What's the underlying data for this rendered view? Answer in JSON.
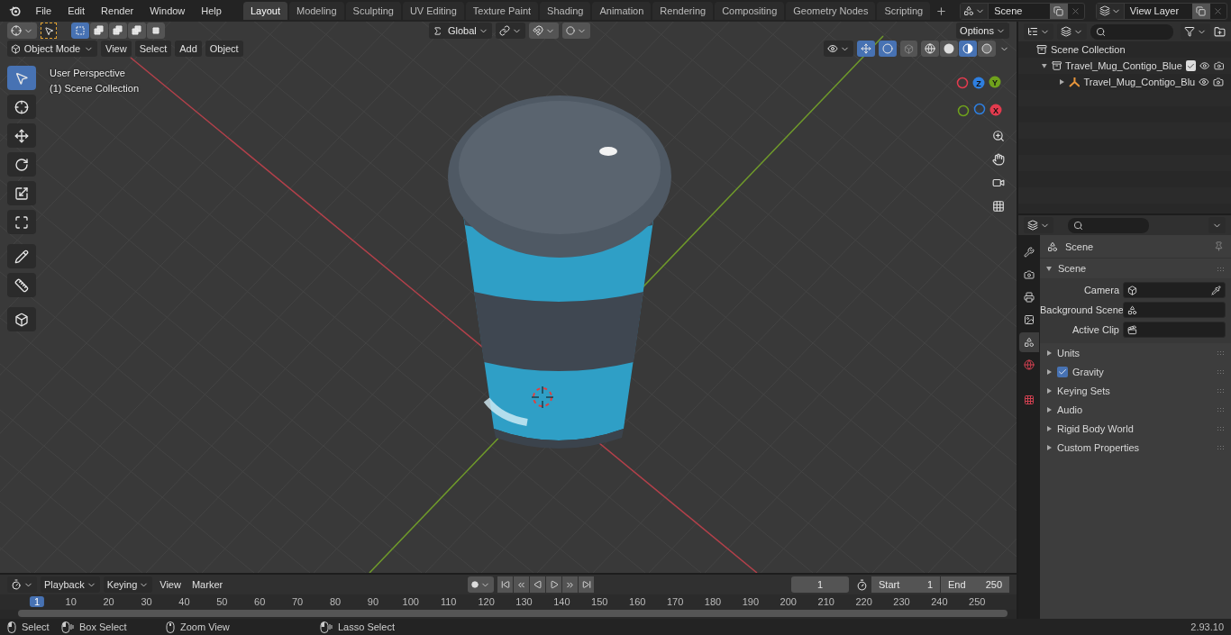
{
  "menu": [
    "File",
    "Edit",
    "Render",
    "Window",
    "Help"
  ],
  "workspaces": [
    {
      "label": "Layout",
      "selected": true
    },
    {
      "label": "Modeling",
      "selected": false
    },
    {
      "label": "Sculpting",
      "selected": false
    },
    {
      "label": "UV Editing",
      "selected": false
    },
    {
      "label": "Texture Paint",
      "selected": false
    },
    {
      "label": "Shading",
      "selected": false
    },
    {
      "label": "Animation",
      "selected": false
    },
    {
      "label": "Rendering",
      "selected": false
    },
    {
      "label": "Compositing",
      "selected": false
    },
    {
      "label": "Geometry Nodes",
      "selected": false
    },
    {
      "label": "Scripting",
      "selected": false
    }
  ],
  "scene": "Scene",
  "view_layer": "View Layer",
  "viewport": {
    "transform_orientation": "Global",
    "options": "Options",
    "mode": "Object Mode",
    "menus": [
      "View",
      "Select",
      "Add",
      "Object"
    ],
    "select_modes": [
      {
        "kind": "new",
        "selected": true
      },
      {
        "kind": "extend",
        "selected": false
      },
      {
        "kind": "subtract",
        "selected": false
      },
      {
        "kind": "invert",
        "selected": false
      },
      {
        "kind": "intersect",
        "selected": false
      }
    ],
    "shading": [
      {
        "kind": "wireframe",
        "selected": false
      },
      {
        "kind": "solid",
        "selected": false
      },
      {
        "kind": "material",
        "selected": true
      },
      {
        "kind": "rendered",
        "selected": false
      }
    ],
    "overlay_lines": [
      "User Perspective",
      "(1) Scene Collection"
    ],
    "tools": [
      {
        "kind": "select",
        "selected": true
      },
      {
        "kind": "cursor",
        "selected": false
      },
      {
        "kind": "move",
        "selected": false
      },
      {
        "kind": "rotate",
        "selected": false
      },
      {
        "kind": "scale",
        "selected": false
      },
      {
        "kind": "transform",
        "selected": false
      },
      {
        "kind": "annotate",
        "selected": false
      },
      {
        "kind": "measure",
        "selected": false
      },
      {
        "kind": "add_cube",
        "selected": false
      }
    ],
    "gizmo_axes": [
      {
        "label": "Z",
        "color": "#2e7fe0"
      },
      {
        "label": "Y",
        "color": "#6fa11c"
      },
      {
        "label": "X",
        "color": "#e33b4e"
      }
    ]
  },
  "outliner": {
    "root": "Scene Collection",
    "items": [
      {
        "label": "Travel_Mug_Contigo_Blue",
        "expanded": true,
        "checked": true,
        "children": [
          {
            "label": "Travel_Mug_Contigo_Blu",
            "expanded": false
          }
        ]
      }
    ]
  },
  "properties": {
    "title": "Scene",
    "tabs": [
      {
        "kind": "tool",
        "selected": false
      },
      {
        "kind": "render",
        "selected": false
      },
      {
        "kind": "output",
        "selected": false
      },
      {
        "kind": "view_layer",
        "selected": false
      },
      {
        "kind": "scene",
        "selected": true
      },
      {
        "kind": "world",
        "selected": false
      },
      {
        "kind": "texture",
        "selected": false
      }
    ],
    "section": {
      "label": "Scene",
      "expanded": true
    },
    "fields": [
      {
        "label": "Camera",
        "kind": "camera"
      },
      {
        "label": "Background Scene",
        "kind": "scene"
      },
      {
        "label": "Active Clip",
        "kind": "clip"
      }
    ],
    "panels": [
      {
        "label": "Units",
        "kind": "plain"
      },
      {
        "label": "Gravity",
        "kind": "checkbox",
        "checked": true
      },
      {
        "label": "Keying Sets",
        "kind": "plain"
      },
      {
        "label": "Audio",
        "kind": "plain"
      },
      {
        "label": "Rigid Body World",
        "kind": "plain"
      },
      {
        "label": "Custom Properties",
        "kind": "plain"
      }
    ]
  },
  "timeline": {
    "menus": [
      {
        "label": "Playback",
        "kind": "dropdown"
      },
      {
        "label": "Keying",
        "kind": "dropdown"
      },
      {
        "label": "View",
        "kind": "plain"
      },
      {
        "label": "Marker",
        "kind": "plain"
      }
    ],
    "current_frame": "1",
    "start_label": "Start",
    "start": "1",
    "end_label": "End",
    "end": "250",
    "ruler": [
      {
        "label": "1",
        "selected": true
      },
      {
        "label": "10",
        "selected": false
      },
      {
        "label": "20",
        "selected": false
      },
      {
        "label": "30",
        "selected": false
      },
      {
        "label": "40",
        "selected": false
      },
      {
        "label": "50",
        "selected": false
      },
      {
        "label": "60",
        "selected": false
      },
      {
        "label": "70",
        "selected": false
      },
      {
        "label": "80",
        "selected": false
      },
      {
        "label": "90",
        "selected": false
      },
      {
        "label": "100",
        "selected": false
      },
      {
        "label": "110",
        "selected": false
      },
      {
        "label": "120",
        "selected": false
      },
      {
        "label": "130",
        "selected": false
      },
      {
        "label": "140",
        "selected": false
      },
      {
        "label": "150",
        "selected": false
      },
      {
        "label": "160",
        "selected": false
      },
      {
        "label": "170",
        "selected": false
      },
      {
        "label": "180",
        "selected": false
      },
      {
        "label": "190",
        "selected": false
      },
      {
        "label": "200",
        "selected": false
      },
      {
        "label": "210",
        "selected": false
      },
      {
        "label": "220",
        "selected": false
      },
      {
        "label": "230",
        "selected": false
      },
      {
        "label": "240",
        "selected": false
      },
      {
        "label": "250",
        "selected": false
      }
    ]
  },
  "status": [
    {
      "label": "Select",
      "kind": "left"
    },
    {
      "label": "Box Select",
      "kind": "drag"
    },
    {
      "label": "Zoom View",
      "kind": "middle"
    },
    {
      "label": "Lasso Select",
      "kind": "drag"
    }
  ],
  "version": "2.93.10"
}
